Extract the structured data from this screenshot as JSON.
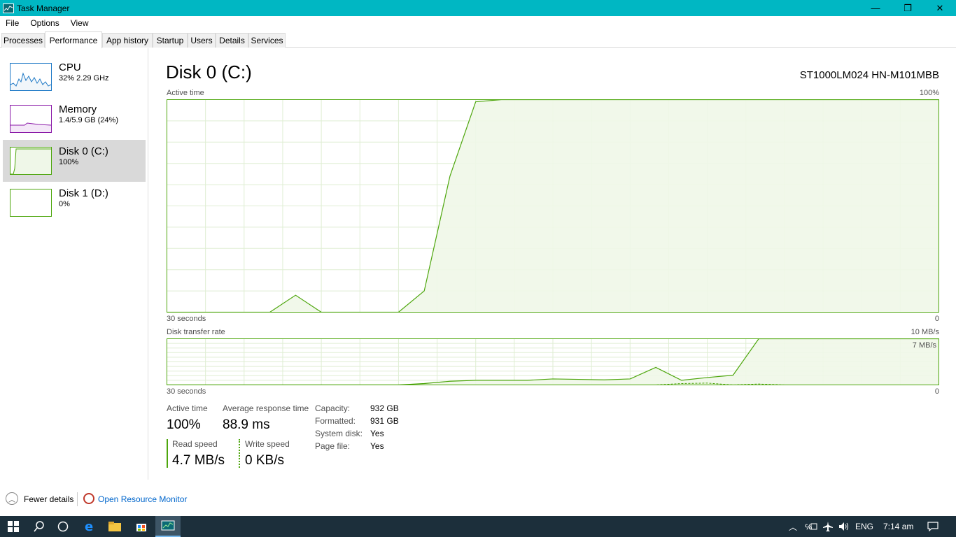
{
  "window": {
    "title": "Task Manager",
    "minimize_glyph": "—",
    "restore_glyph": "❐",
    "close_glyph": "✕"
  },
  "menu": [
    "File",
    "Options",
    "View"
  ],
  "tabs": [
    "Processes",
    "Performance",
    "App history",
    "Startup",
    "Users",
    "Details",
    "Services"
  ],
  "active_tab": "Performance",
  "sidebar": {
    "items": [
      {
        "name": "CPU",
        "sub": "32%  2.29 GHz",
        "color": "#1e79c6",
        "fill": "#f1f6fa"
      },
      {
        "name": "Memory",
        "sub": "1.4/5.9 GB (24%)",
        "color": "#8b1aa8",
        "fill": "#f4e8f8"
      },
      {
        "name": "Disk 0 (C:)",
        "sub": "100%",
        "color": "#4da60c",
        "fill": "#eff7e8"
      },
      {
        "name": "Disk 1 (D:)",
        "sub": "0%",
        "color": "#4da60c",
        "fill": "#ffffff"
      }
    ],
    "selected_index": 2
  },
  "main": {
    "title": "Disk 0 (C:)",
    "model": "ST1000LM024 HN-M101MBB",
    "active_chart": {
      "label": "Active time",
      "max_label": "100%",
      "time_label": "30 seconds",
      "min_label": "0"
    },
    "transfer_chart": {
      "label": "Disk transfer rate",
      "max_label": "10 MB/s",
      "secondary_label": "7 MB/s",
      "time_label": "30 seconds",
      "min_label": "0"
    },
    "stats": {
      "active_time_label": "Active time",
      "active_time_value": "100%",
      "avg_response_label": "Average response time",
      "avg_response_value": "88.9 ms",
      "read_speed_label": "Read speed",
      "read_speed_value": "4.7 MB/s",
      "write_speed_label": "Write speed",
      "write_speed_value": "0 KB/s"
    },
    "properties": [
      {
        "label": "Capacity:",
        "value": "932 GB"
      },
      {
        "label": "Formatted:",
        "value": "931 GB"
      },
      {
        "label": "System disk:",
        "value": "Yes"
      },
      {
        "label": "Page file:",
        "value": "Yes"
      }
    ]
  },
  "chart_data": [
    {
      "type": "area",
      "title": "Active time",
      "xlabel": "30 seconds",
      "ylabel": "",
      "ylim": [
        0,
        100
      ],
      "x": [
        0,
        1,
        2,
        3,
        4,
        5,
        6,
        7,
        8,
        9,
        10,
        11,
        12,
        13,
        14,
        15,
        16,
        17,
        18,
        19,
        20,
        21,
        22,
        23,
        24,
        25,
        26,
        27,
        28,
        29,
        30
      ],
      "series": [
        {
          "values": [
            0,
            0,
            0,
            0,
            0,
            8,
            0,
            0,
            0,
            0,
            10,
            64,
            99,
            100,
            100,
            100,
            100,
            100,
            100,
            100,
            100,
            100,
            100,
            100,
            100,
            100,
            100,
            100,
            100,
            100,
            100
          ]
        }
      ]
    },
    {
      "type": "area",
      "title": "Disk transfer rate",
      "xlabel": "30 seconds",
      "ylabel": "",
      "ylim": [
        0,
        10
      ],
      "x": [
        0,
        1,
        2,
        3,
        4,
        5,
        6,
        7,
        8,
        9,
        10,
        11,
        12,
        13,
        14,
        15,
        16,
        17,
        18,
        19,
        20,
        21,
        22,
        23,
        24,
        25,
        26,
        27,
        28,
        29,
        30
      ],
      "series": [
        {
          "values": [
            0,
            0,
            0,
            0,
            0,
            0,
            0,
            0,
            0,
            0,
            0.3,
            0.8,
            1.0,
            1.0,
            1.0,
            1.3,
            1.2,
            1.1,
            1.3,
            3.8,
            1.0,
            1.6,
            2.1,
            10,
            10,
            10,
            10,
            10,
            10,
            10,
            10
          ]
        },
        {
          "values": [
            0,
            0,
            0,
            0,
            0,
            0,
            0,
            0,
            0,
            0,
            0,
            0,
            0,
            0,
            0,
            0,
            0,
            0,
            0,
            0,
            0.3,
            0.4,
            0,
            0.2,
            0,
            0,
            0,
            0,
            0,
            0,
            0
          ]
        }
      ]
    }
  ],
  "footer": {
    "fewer_details": "Fewer details",
    "open_resource_monitor": "Open Resource Monitor"
  },
  "taskbar": {
    "tray_lang": "ENG",
    "clock": "7:14 am"
  }
}
